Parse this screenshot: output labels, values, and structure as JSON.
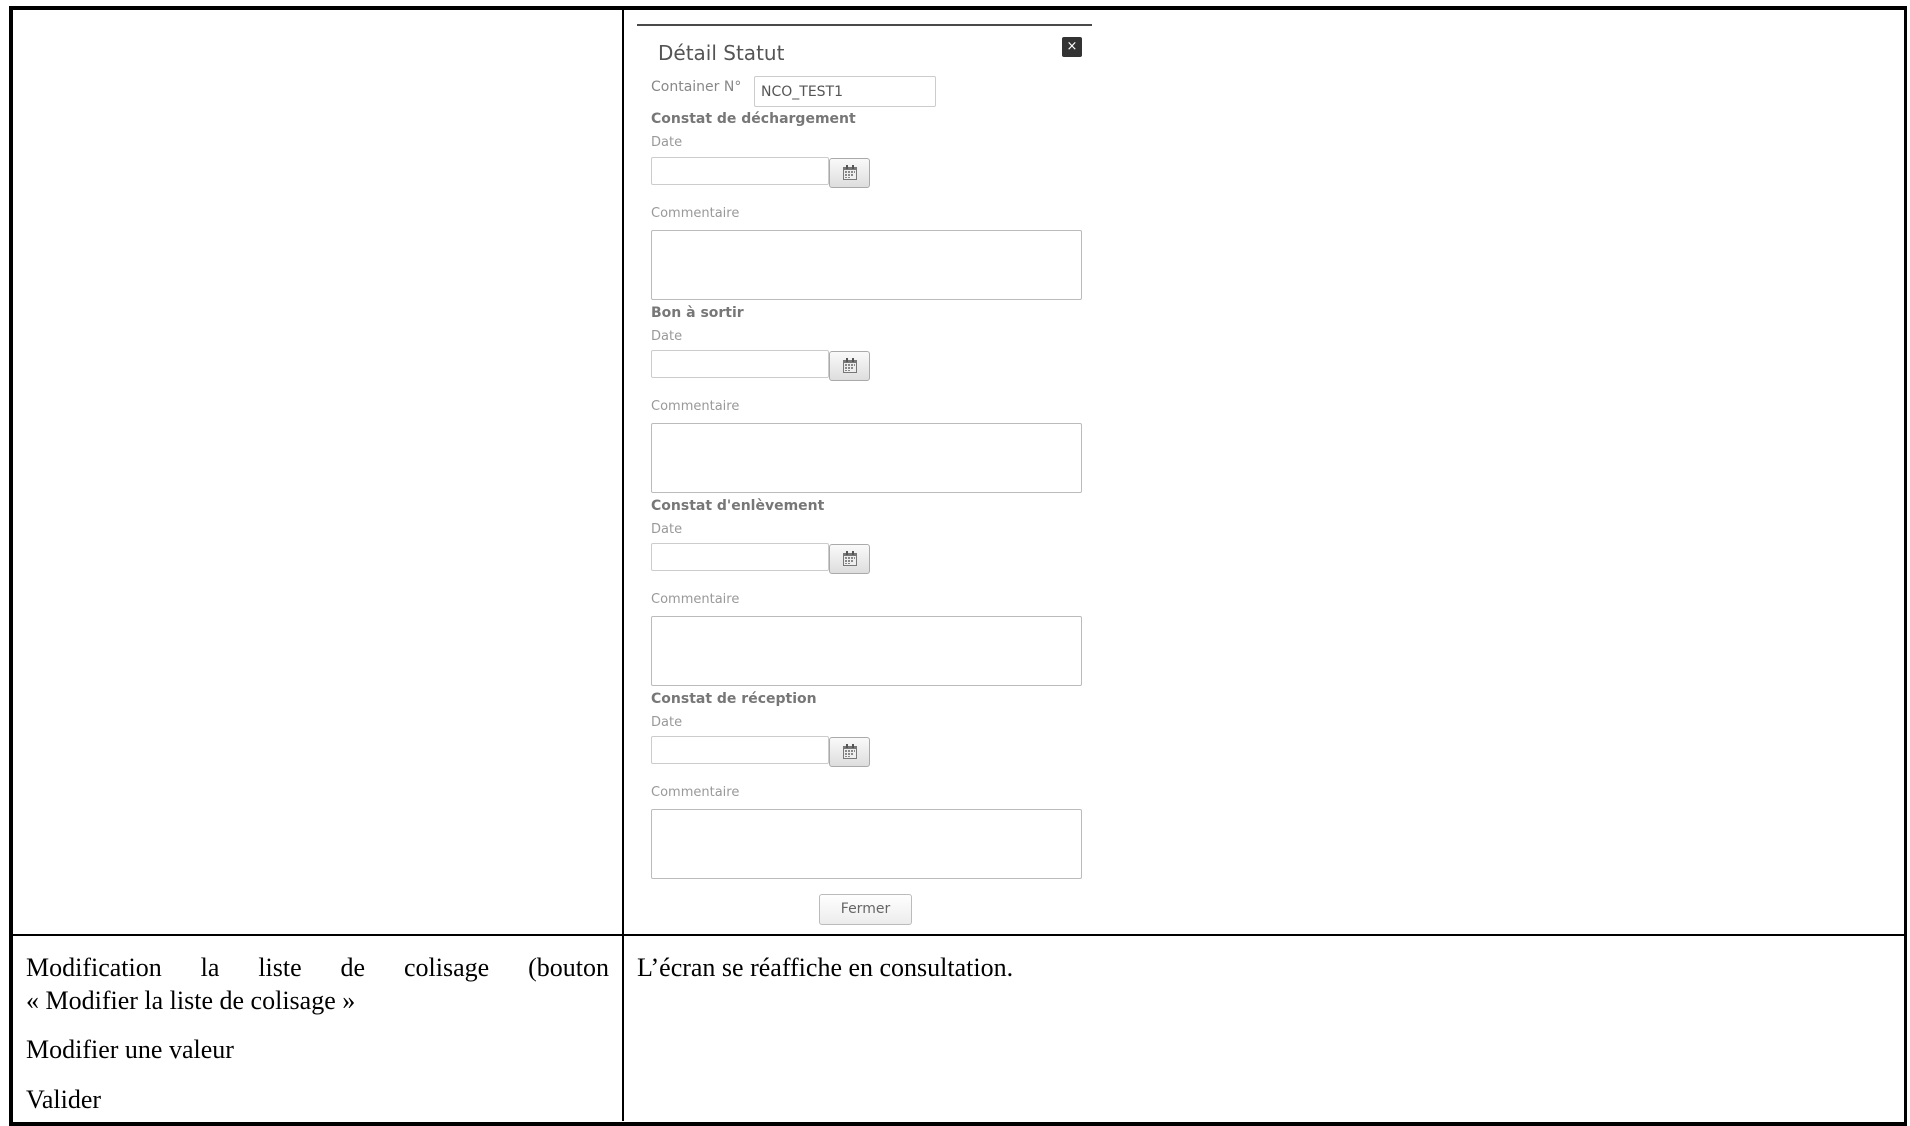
{
  "dialog": {
    "title": "Détail Statut",
    "close_label": "×",
    "container_label": "Container N°",
    "container_value": "NCO_TEST1",
    "sections": [
      {
        "title": "Constat de déchargement",
        "date_label": "Date",
        "comment_label": "Commentaire"
      },
      {
        "title": "Bon à sortir",
        "date_label": "Date",
        "comment_label": "Commentaire"
      },
      {
        "title": "Constat d'enlèvement",
        "date_label": "Date",
        "comment_label": "Commentaire"
      },
      {
        "title": "Constat de réception",
        "date_label": "Date",
        "comment_label": "Commentaire"
      }
    ],
    "close_button": "Fermer",
    "calendar_icon": "calendar-icon"
  },
  "row2": {
    "left": {
      "line1_words": [
        "Modification",
        "la",
        "liste",
        "de",
        "colisage",
        "(bouton"
      ],
      "line2": "« Modifier la liste de colisage »",
      "line3": "Modifier une valeur",
      "line4": "Valider"
    },
    "right": "L’écran se réaffiche en consultation."
  }
}
